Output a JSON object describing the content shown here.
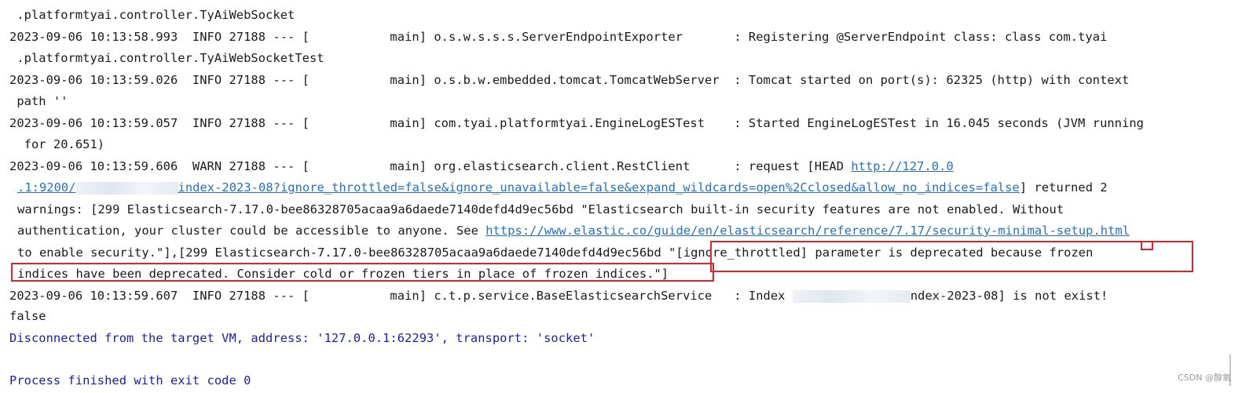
{
  "console": {
    "l0": " .platformtyai.controller.TyAiWebSocket",
    "l1": "2023-09-06 10:13:58.993  INFO 27188 --- [           main] o.s.w.s.s.s.ServerEndpointExporter       : Registering @ServerEndpoint class: class com.tyai",
    "l2": " .platformtyai.controller.TyAiWebSocketTest",
    "l3": "2023-09-06 10:13:59.026  INFO 27188 --- [           main] o.s.b.w.embedded.tomcat.TomcatWebServer  : Tomcat started on port(s): 62325 (http) with context",
    "l4": " path ''",
    "l5": "2023-09-06 10:13:59.057  INFO 27188 --- [           main] com.tyai.platformtyai.EngineLogESTest    : Started EngineLogESTest in 16.045 seconds (JVM running",
    "l6": "  for 20.651)",
    "l7_text": "2023-09-06 10:13:59.606  WARN 27188 --- [           main] org.elasticsearch.client.RestClient      : request [HEAD ",
    "l7_link": "http://127.0.0",
    "l8_link_a": ".1:9200/",
    "l8_link_b": "index-2023-08?ignore_throttled=false&ignore_unavailable=false&expand_wildcards=open%2Cclosed&allow_no_indices=false",
    "l8_tail": "] returned 2",
    "l9": "warnings: [299 Elasticsearch-7.17.0-bee86328705acaa9a6daede7140defd4d9ec56bd \"Elasticsearch built-in security features are not enabled. Without",
    "l10_text": "authentication, your cluster could be accessible to anyone. See ",
    "l10_link": "https://www.elastic.co/guide/en/elasticsearch/reference/7.17/security-minimal-setup.html",
    "l11": "to enable security.\"],[299 Elasticsearch-7.17.0-bee86328705acaa9a6daede7140defd4d9ec56bd \"[ignore_throttled] parameter is deprecated because frozen",
    "l12": "indices have been deprecated. Consider cold or frozen tiers in place of frozen indices.\"]",
    "l13_a": "2023-09-06 10:13:59.607  INFO 27188 --- [           main] c.t.p.service.BaseElasticsearchService   : Index ",
    "l13_b": "ndex-2023-08] is not exist!",
    "l14": "false",
    "l15": "Disconnected from the target VM, address: '127.0.0.1:62293', transport: 'socket'",
    "l16": "Process finished with exit code 0"
  },
  "watermark": "CSDN @醇氧",
  "colors": {
    "text": "#1a1a1a",
    "system": "#1d1ca6",
    "link": "#2470c4",
    "highlight": "#e0222d"
  }
}
